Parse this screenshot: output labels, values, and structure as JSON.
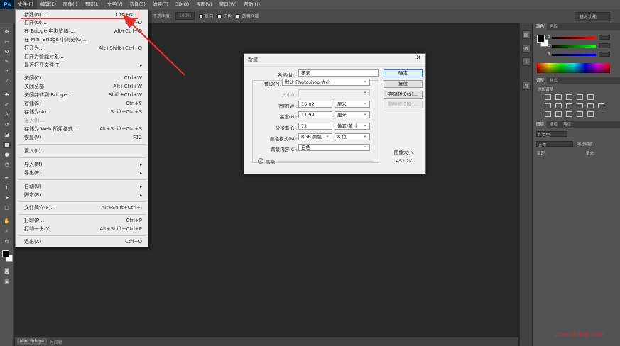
{
  "app": {
    "logo": "Ps"
  },
  "menubar": {
    "items": [
      "文件(F)",
      "编辑(E)",
      "图像(I)",
      "图层(L)",
      "文字(Y)",
      "选择(S)",
      "滤镜(T)",
      "3D(D)",
      "视图(V)",
      "窗口(W)",
      "帮助(H)"
    ]
  },
  "options": {
    "mode_label": "不透明度:",
    "opacity": "100%",
    "chk1": "反向",
    "chk2": "仿色",
    "chk3": "透明区域",
    "workspace": "基本功能"
  },
  "file_menu": {
    "items": [
      {
        "label": "新建(N)...",
        "shortcut": "Ctrl+N",
        "state": "highlight"
      },
      {
        "label": "打开(O)...",
        "shortcut": "Ctrl+O"
      },
      {
        "label": "在 Bridge 中浏览(B)...",
        "shortcut": "Alt+Ctrl+O"
      },
      {
        "label": "在 Mini Bridge 中浏览(G)...",
        "shortcut": ""
      },
      {
        "label": "打开为...",
        "shortcut": "Alt+Shift+Ctrl+O"
      },
      {
        "label": "打开为智能对象...",
        "shortcut": ""
      },
      {
        "label": "最近打开文件(T)",
        "shortcut": "",
        "submenu": true
      },
      {
        "label": "关闭(C)",
        "shortcut": "Ctrl+W"
      },
      {
        "label": "关闭全部",
        "shortcut": "Alt+Ctrl+W"
      },
      {
        "label": "关闭并转到 Bridge...",
        "shortcut": "Shift+Ctrl+W"
      },
      {
        "label": "存储(S)",
        "shortcut": "Ctrl+S"
      },
      {
        "label": "存储为(A)...",
        "shortcut": "Shift+Ctrl+S"
      },
      {
        "label": "签入(I)...",
        "shortcut": "",
        "disabled": true
      },
      {
        "label": "存储为 Web 所用格式...",
        "shortcut": "Alt+Shift+Ctrl+S"
      },
      {
        "label": "恢复(V)",
        "shortcut": "F12"
      },
      {
        "label": "置入(L)...",
        "shortcut": ""
      },
      {
        "label": "导入(M)",
        "shortcut": "",
        "submenu": true
      },
      {
        "label": "导出(E)",
        "shortcut": "",
        "submenu": true
      },
      {
        "label": "自动(U)",
        "shortcut": "",
        "submenu": true
      },
      {
        "label": "脚本(R)",
        "shortcut": "",
        "submenu": true
      },
      {
        "label": "文件简介(F)...",
        "shortcut": "Alt+Shift+Ctrl+I"
      },
      {
        "label": "打印(P)...",
        "shortcut": "Ctrl+P"
      },
      {
        "label": "打印一份(Y)",
        "shortcut": "Alt+Shift+Ctrl+P"
      },
      {
        "label": "退出(X)",
        "shortcut": "Ctrl+Q"
      }
    ]
  },
  "dialog": {
    "title": "新建",
    "name_label": "名称(N):",
    "name_value": "筱安",
    "preset_label": "预设(P):",
    "preset_value": "默认 Photoshop 大小",
    "size_label": "大小(I):",
    "width_label": "宽度(W):",
    "width_value": "16.02",
    "width_unit": "厘米",
    "height_label": "高度(H):",
    "height_value": "11.99",
    "height_unit": "厘米",
    "res_label": "分辨率(R):",
    "res_value": "72",
    "res_unit": "像素/英寸",
    "mode_label": "颜色模式(M):",
    "mode_value": "RGB 颜色",
    "mode_bits": "8 位",
    "bg_label": "背景内容(C):",
    "bg_value": "白色",
    "advanced": "高级",
    "ok": "确定",
    "reset": "复位",
    "save_preset": "存储预设(S)...",
    "delete_preset": "删除预设(D)...",
    "image_size_label": "图像大小:",
    "image_size_value": "452.2K"
  },
  "panels": {
    "color_tabs": [
      "颜色",
      "色板"
    ],
    "r": "R",
    "g": "G",
    "b": "B",
    "adj_tabs": [
      "调整",
      "样式"
    ],
    "adj_label": "添加调整",
    "layer_tabs": [
      "图层",
      "通道",
      "路径"
    ],
    "kind": "P 类型",
    "blend": "正常",
    "opacity_label": "不透明度:",
    "lock_label": "锁定:",
    "fill_label": "填充:"
  },
  "status": {
    "tab1": "Mini Bridge",
    "tab2": "时间轴"
  },
  "watermark": "zhanshaoyi.com",
  "colors": {
    "highlight_outline": "#e33333",
    "arrow": "#e3302f"
  }
}
